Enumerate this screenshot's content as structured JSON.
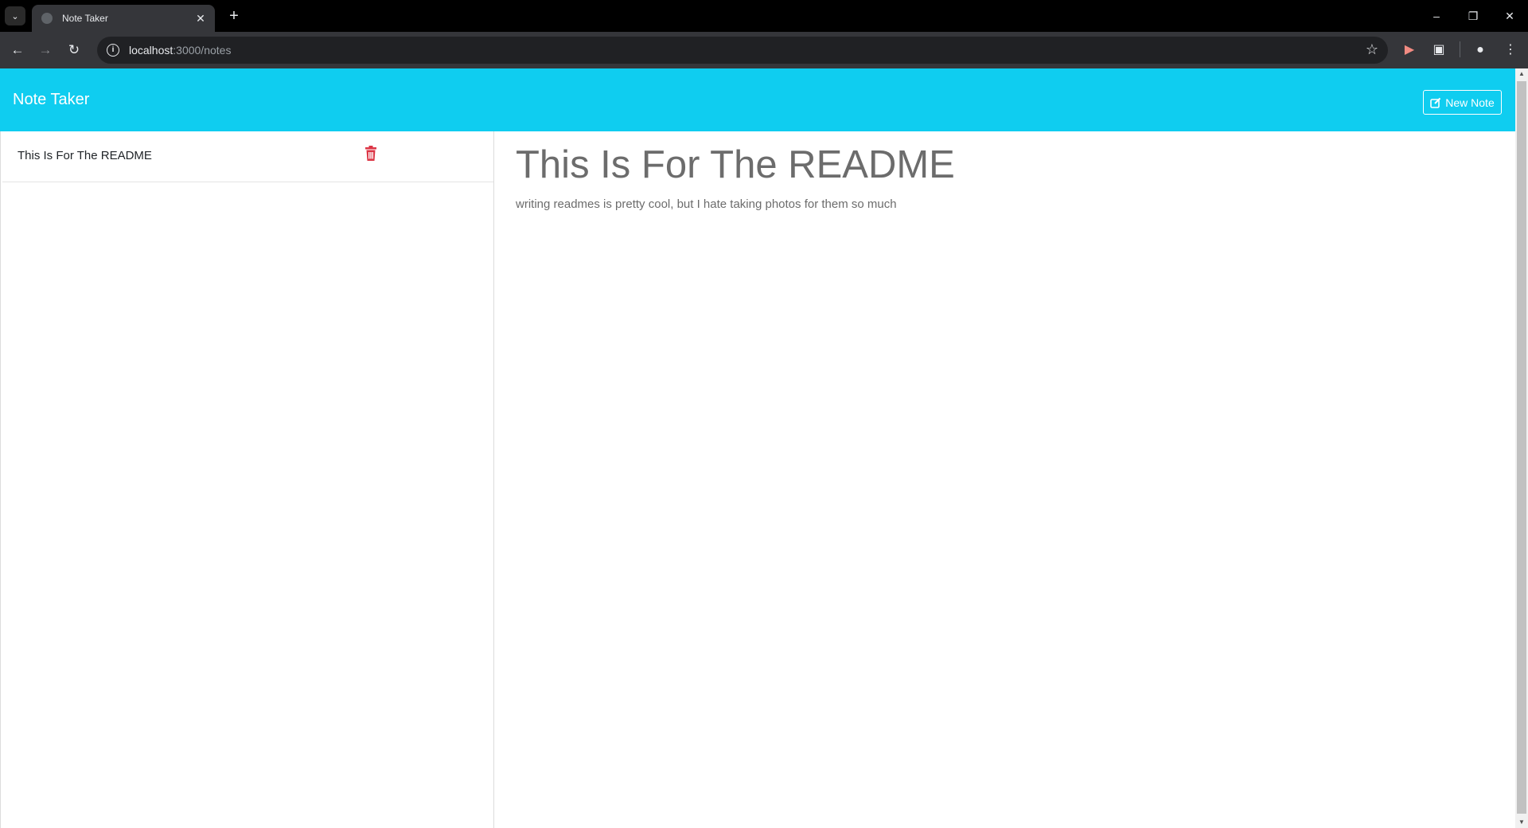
{
  "browser": {
    "tab_title": "Note Taker",
    "url_host": "localhost",
    "url_rest": ":3000/notes"
  },
  "app": {
    "brand": "Note Taker",
    "new_note_label": "New Note"
  },
  "notes": [
    {
      "title": "This Is For The README"
    }
  ],
  "active_note": {
    "title": "This Is For The README",
    "text": "writing readmes is pretty cool, but I hate taking photos for them so much"
  },
  "colors": {
    "navbar": "#0fcdf0",
    "delete": "#dc3545"
  },
  "icons": {
    "new_note": "edit-icon",
    "delete": "trash-icon"
  }
}
